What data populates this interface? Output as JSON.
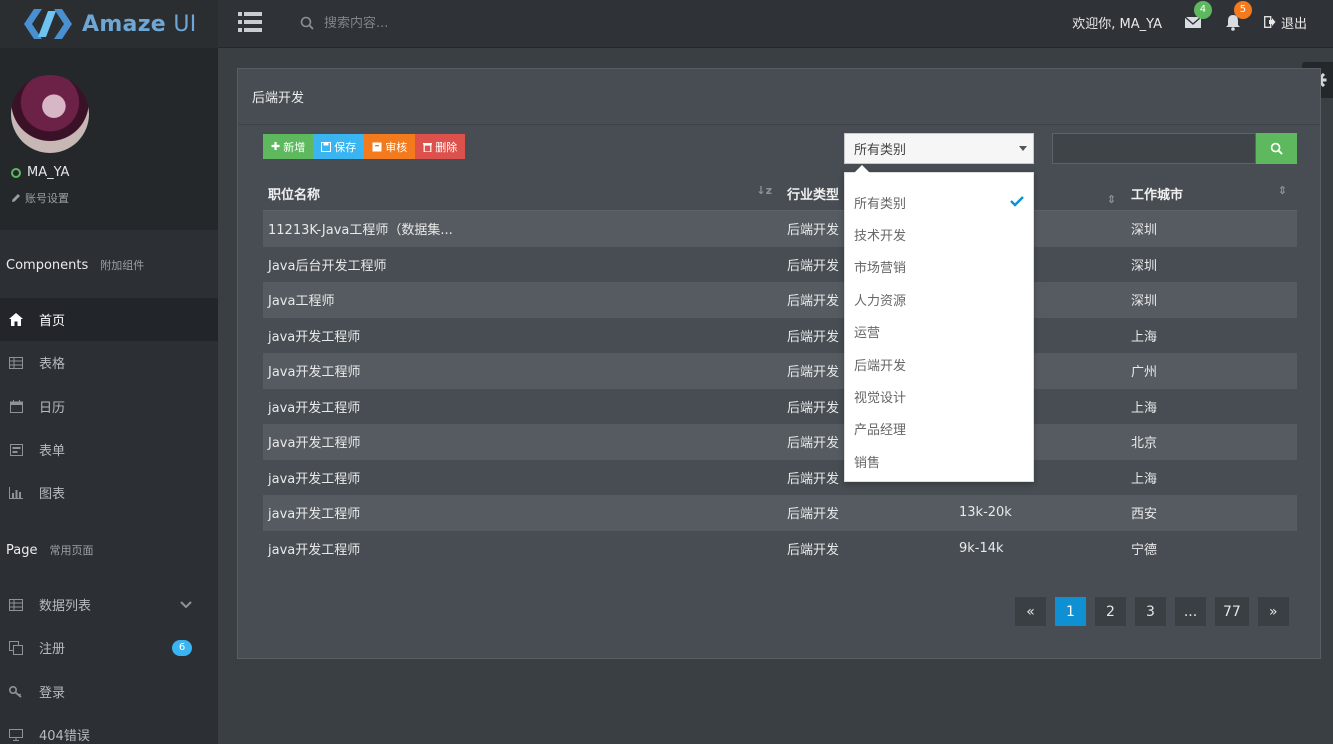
{
  "brand": {
    "name": "Amaze",
    "suffix": " UI"
  },
  "topbar": {
    "search_placeholder": "搜索内容...",
    "welcome": "欢迎你, MA_YA",
    "mail_count": "4",
    "notify_count": "5",
    "logout": "退出"
  },
  "sidebar": {
    "username": "MA_YA",
    "account_settings": "账号设置",
    "components_title": "Components",
    "components_sub": "附加组件",
    "components_items": [
      {
        "label": "首页",
        "icon": "home-icon"
      },
      {
        "label": "表格",
        "icon": "table-icon"
      },
      {
        "label": "日历",
        "icon": "calendar-icon"
      },
      {
        "label": "表单",
        "icon": "form-icon"
      },
      {
        "label": "图表",
        "icon": "chart-icon"
      }
    ],
    "page_title": "Page",
    "page_sub": "常用页面",
    "page_items": [
      {
        "label": "数据列表",
        "icon": "table-icon"
      },
      {
        "label": "注册",
        "icon": "copy-icon",
        "badge": "6"
      },
      {
        "label": "登录",
        "icon": "key-icon"
      },
      {
        "label": "404错误",
        "icon": "monitor-icon"
      }
    ]
  },
  "panel": {
    "title": "后端开发",
    "buttons": {
      "add": "新增",
      "save": "保存",
      "review": "审核",
      "delete": "删除"
    },
    "select_value": "所有类别",
    "dropdown_options": [
      "所有类别",
      "技术开发",
      "市场营销",
      "人力资源",
      "运营",
      "后端开发",
      "视觉设计",
      "产品经理",
      "销售"
    ],
    "table": {
      "headers": [
        "职位名称",
        "行业类型",
        "",
        "工作城市"
      ],
      "rows": [
        [
          "11213K-Java工程师（数据集...",
          "后端开发",
          "",
          "深圳"
        ],
        [
          "Java后台开发工程师",
          "后端开发",
          "",
          "深圳"
        ],
        [
          "Java工程师",
          "后端开发",
          "",
          "深圳"
        ],
        [
          "java开发工程师",
          "后端开发",
          "",
          "上海"
        ],
        [
          "Java开发工程师",
          "后端开发",
          "",
          "广州"
        ],
        [
          "java开发工程师",
          "后端开发",
          "",
          "上海"
        ],
        [
          "Java开发工程师",
          "后端开发",
          "",
          "北京"
        ],
        [
          "java开发工程师",
          "后端开发",
          "",
          "上海"
        ],
        [
          "java开发工程师",
          "后端开发",
          "13k-20k",
          "西安"
        ],
        [
          "java开发工程师",
          "后端开发",
          "9k-14k",
          "宁德"
        ]
      ]
    },
    "pagination": [
      "«",
      "1",
      "2",
      "3",
      "...",
      "77",
      "»"
    ],
    "active_page": "1"
  },
  "colors": {
    "accent": "#0e90d2",
    "success": "#5eb95e",
    "warning": "#f37b1d",
    "danger": "#dd514c",
    "info": "#3bb4f2"
  }
}
